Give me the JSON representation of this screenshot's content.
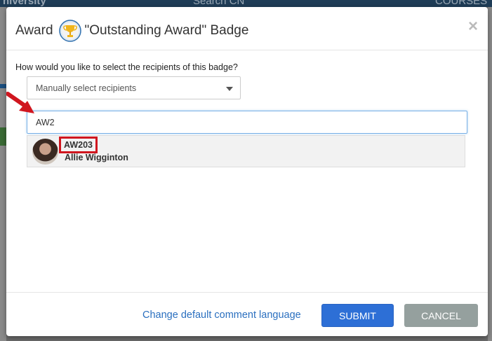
{
  "background": {
    "topbar": {
      "brand": "niversity",
      "search_placeholder": "Search CN",
      "courses_label": "COURSES"
    }
  },
  "modal": {
    "title_prefix": "Award",
    "title_badge_name": "\"Outstanding Award\" Badge",
    "badge_icon": "trophy-badge-icon",
    "close_label": "×",
    "question": "How would you like to select the recipients of this badge?",
    "selection_mode": {
      "selected": "Manually select recipients"
    },
    "search": {
      "value": "AW2"
    },
    "suggestion": {
      "code": "AW203",
      "name": "Allie Wigginton"
    },
    "footer": {
      "change_language_label": "Change default comment language",
      "submit_label": "SUBMIT",
      "cancel_label": "CANCEL"
    }
  },
  "colors": {
    "submit_bg": "#2d6fd6",
    "cancel_bg": "#95a09e",
    "highlight_red": "#d0161f",
    "link_blue": "#2a6fbf"
  }
}
